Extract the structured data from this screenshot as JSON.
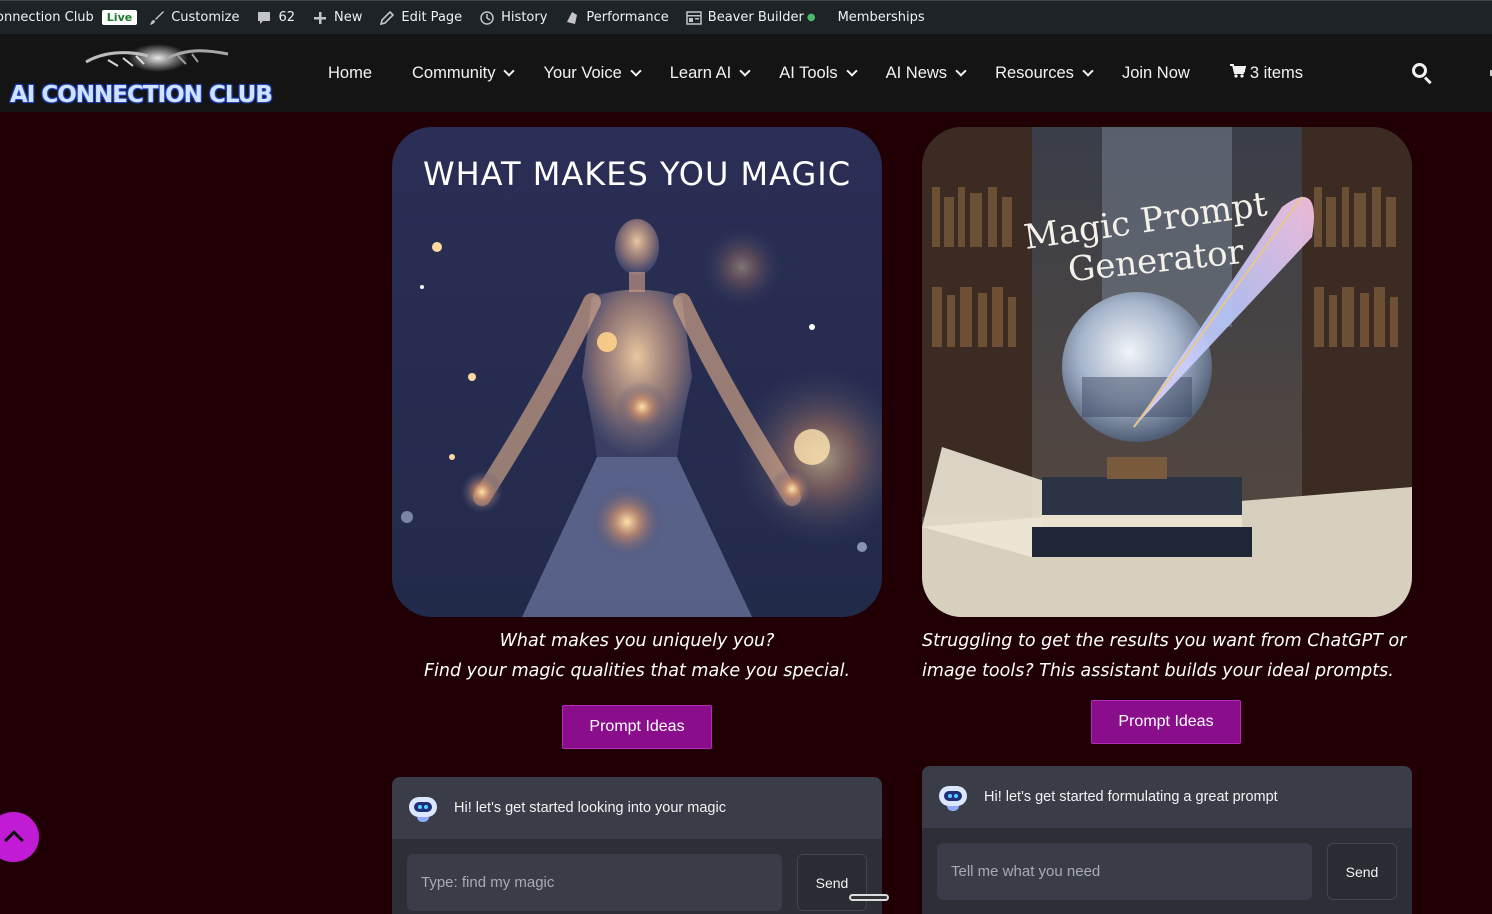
{
  "admin_bar": {
    "site_name": "onnection Club",
    "live_badge": "Live",
    "customize": "Customize",
    "comments_count": "62",
    "new": "New",
    "edit_page": "Edit Page",
    "history": "History",
    "performance": "Performance",
    "beaver_builder": "Beaver Builder",
    "memberships": "Memberships"
  },
  "header": {
    "logo_text": "AI CONNECTION CLUB",
    "nav": {
      "home": "Home",
      "community": "Community",
      "your_voice": "Your Voice",
      "learn_ai": "Learn AI",
      "ai_tools": "AI Tools",
      "ai_news": "AI News",
      "resources": "Resources",
      "join_now": "Join Now",
      "cart": "3 items"
    }
  },
  "cards": {
    "magic": {
      "image_title": "WHAT MAKES YOU MAGIC",
      "caption_line1": "What makes you uniquely you?",
      "caption_line2": "Find your magic qualities that make you special.",
      "button": "Prompt Ideas",
      "chat_greeting": "Hi! let's get started looking into your magic",
      "input_placeholder": "Type: find my magic",
      "send": "Send"
    },
    "prompt": {
      "image_title_line1": "Magic Prompt",
      "image_title_line2": "Generator",
      "caption_line1": "Struggling to get the results you want from ChatGPT or",
      "caption_line2": "image tools? This assistant builds your ideal prompts.",
      "button": "Prompt Ideas",
      "chat_greeting": "Hi! let's get started formulating a great prompt",
      "input_placeholder": "Tell me what you need",
      "send": "Send"
    }
  },
  "colors": {
    "page_bg": "#200005",
    "button_bg": "#8a0d8c",
    "scroll_top_bg": "#c21bd6",
    "live_badge_text": "#1a7b2f"
  }
}
